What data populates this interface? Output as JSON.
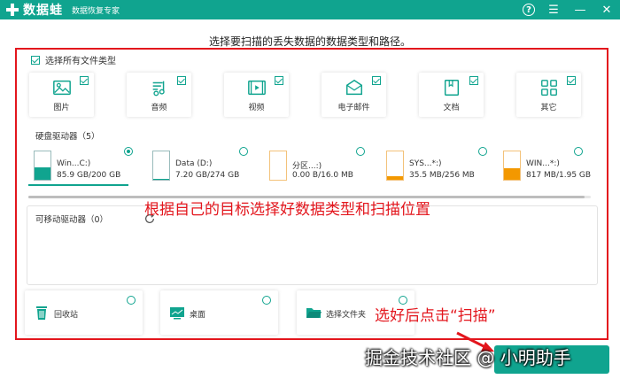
{
  "app": {
    "logo_text": "数据蛙",
    "subtitle": "数据恢复专家"
  },
  "window": {
    "help_glyph": "?",
    "menu_glyph": "☰",
    "minimize_glyph": "—",
    "close_glyph": "✕"
  },
  "heading": "选择要扫描的丢失数据的数据类型和路径。",
  "select_all": {
    "label": "选择所有文件类型",
    "checked": true
  },
  "file_types": [
    {
      "label": "图片",
      "icon": "image-icon",
      "checked": true
    },
    {
      "label": "音频",
      "icon": "audio-icon",
      "checked": true
    },
    {
      "label": "视频",
      "icon": "video-icon",
      "checked": true
    },
    {
      "label": "电子邮件",
      "icon": "email-icon",
      "checked": true
    },
    {
      "label": "文档",
      "icon": "document-icon",
      "checked": true
    },
    {
      "label": "其它",
      "icon": "other-icon",
      "checked": true
    }
  ],
  "hard_drives": {
    "title": "硬盘驱动器（5）",
    "items": [
      {
        "name": "Win...C:)",
        "size": "85.9 GB/200 GB",
        "fill_fraction": 0.43,
        "color": "#10a48f",
        "selected": true
      },
      {
        "name": "Data (D:)",
        "size": "7.20 GB/274 GB",
        "fill_fraction": 0.03,
        "color": "#10a48f",
        "selected": false
      },
      {
        "name": "分区...:)",
        "size": "0.00  B/16.0 MB",
        "fill_fraction": 0.0,
        "color": "#f39800",
        "selected": false
      },
      {
        "name": "SYS...*:)",
        "size": "35.5 MB/256 MB",
        "fill_fraction": 0.14,
        "color": "#f39800",
        "selected": false
      },
      {
        "name": "WIN...*:)",
        "size": "817 MB/1.95 GB",
        "fill_fraction": 0.41,
        "color": "#f39800",
        "selected": false
      }
    ]
  },
  "removable": {
    "title": "可移动驱动器（0）"
  },
  "locations": [
    {
      "label": "回收站",
      "icon": "recycle-bin-icon"
    },
    {
      "label": "桌面",
      "icon": "desktop-icon"
    },
    {
      "label": "选择文件夹",
      "icon": "folder-icon"
    }
  ],
  "annotations": {
    "main": "根据自己的目标选择好数据类型和扫描位置",
    "scan_hint": "选好后点击“扫描”"
  },
  "watermark": "掘金技术社区 @ 小明助手",
  "colors": {
    "accent": "#10a48f",
    "annotation_red": "#e3161d",
    "warning_orange": "#f39800"
  }
}
